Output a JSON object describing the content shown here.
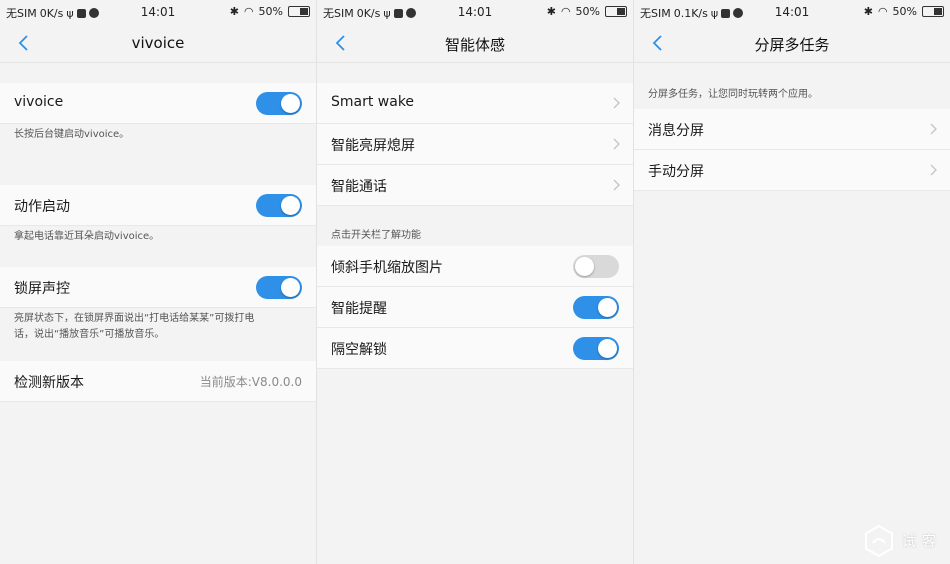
{
  "status_bars": [
    {
      "carrier": "无SIM",
      "speed": "0K/s",
      "time": "14:01",
      "battery": "50%"
    },
    {
      "carrier": "无SIM",
      "speed": "0K/s",
      "time": "14:01",
      "battery": "50%"
    },
    {
      "carrier": "无SIM",
      "speed": "0.1K/s",
      "time": "14:01",
      "battery": "50%"
    }
  ],
  "panel1": {
    "title": "vivoice",
    "vivoice": {
      "label": "vivoice",
      "on": true
    },
    "vivoice_note": "长按后台键启动vivoice。",
    "action": {
      "label": "动作启动",
      "on": true
    },
    "action_note": "拿起电话靠近耳朵启动vivoice。",
    "lock": {
      "label": "锁屏声控",
      "on": true
    },
    "lock_note_line1": "亮屏状态下，在锁屏界面说出“打电话给某某”可拨打电",
    "lock_note_line2": "话，说出“播放音乐”可播放音乐。",
    "update": {
      "label": "检测新版本",
      "value": "当前版本:V8.0.0.0"
    }
  },
  "panel2": {
    "title": "智能体感",
    "items": [
      {
        "label": "Smart wake"
      },
      {
        "label": "智能亮屏熄屏"
      },
      {
        "label": "智能通话"
      }
    ],
    "section_note": "点击开关栏了解功能",
    "toggles": [
      {
        "label": "倾斜手机缩放图片",
        "on": false
      },
      {
        "label": "智能提醒",
        "on": true
      },
      {
        "label": "隔空解锁",
        "on": true
      }
    ]
  },
  "panel3": {
    "title": "分屏多任务",
    "note": "分屏多任务，让您同时玩转两个应用。",
    "items": [
      {
        "label": "消息分屏"
      },
      {
        "label": "手动分屏"
      }
    ]
  },
  "watermark": {
    "text": "试客"
  },
  "colors": {
    "accent": "#2f90e8",
    "toggle_off": "#d9d9d9"
  }
}
